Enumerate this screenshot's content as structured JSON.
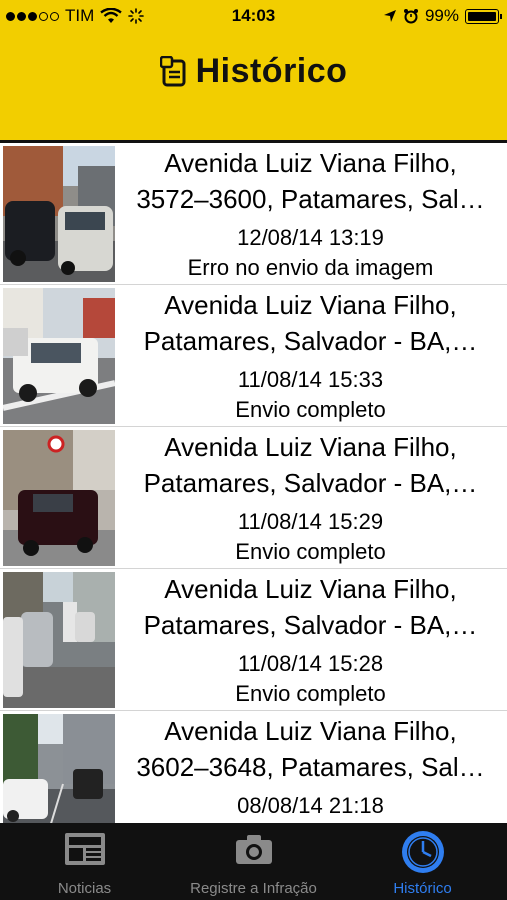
{
  "status_bar": {
    "carrier": "TIM",
    "time": "14:03",
    "battery": "99%"
  },
  "header": {
    "title": "Histórico"
  },
  "records": [
    {
      "address": "Avenida Luiz Viana Filho,\n3572–3600, Patamares, Sal…",
      "date": "12/08/14 13:19",
      "status": "Erro no envio da imagem"
    },
    {
      "address": "Avenida Luiz Viana Filho,\nPatamares, Salvador - BA,…",
      "date": "11/08/14 15:33",
      "status": "Envio completo"
    },
    {
      "address": "Avenida Luiz Viana Filho,\nPatamares, Salvador - BA,…",
      "date": "11/08/14 15:29",
      "status": "Envio completo"
    },
    {
      "address": "Avenida Luiz Viana Filho,\nPatamares, Salvador - BA,…",
      "date": "11/08/14 15:28",
      "status": "Envio completo"
    },
    {
      "address": "Avenida Luiz Viana Filho,\n3602–3648, Patamares, Sal…",
      "date": "08/08/14 21:18",
      "status": ""
    }
  ],
  "tabs": [
    {
      "label": "Noticias",
      "icon": "newspaper-icon",
      "active": false
    },
    {
      "label": "Registre a Infração",
      "icon": "camera-icon",
      "active": false
    },
    {
      "label": "Histórico",
      "icon": "clock-icon",
      "active": true
    }
  ],
  "colors": {
    "header": "#f2ce00",
    "tab_active": "#2f7ef0",
    "tab_inactive": "#8a8a8a",
    "tabbar": "#111111"
  }
}
